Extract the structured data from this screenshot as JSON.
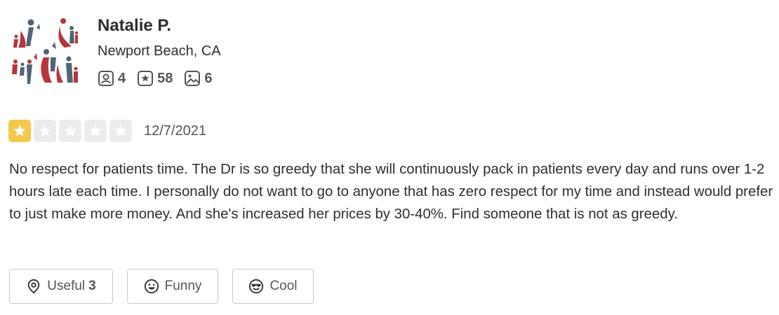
{
  "user": {
    "name": "Natalie P.",
    "location": "Newport Beach, CA",
    "stats": [
      {
        "icon": "friends-icon",
        "value": "4"
      },
      {
        "icon": "review-star-icon",
        "value": "58"
      },
      {
        "icon": "photo-icon",
        "value": "6"
      }
    ]
  },
  "review": {
    "rating": 1,
    "max_rating": 5,
    "date": "12/7/2021",
    "text": "No respect for patients time. The Dr is so greedy that she will continuously pack in patients every day and runs over 1-2 hours late each time. I personally do not want to go to anyone that has zero respect for my time and instead would prefer to just make more money. And she's increased her prices by 30-40%. Find someone that is not as greedy."
  },
  "reactions": [
    {
      "icon": "useful-icon",
      "label": "Useful",
      "count": "3"
    },
    {
      "icon": "funny-icon",
      "label": "Funny",
      "count": ""
    },
    {
      "icon": "cool-icon",
      "label": "Cool",
      "count": ""
    }
  ],
  "colors": {
    "star_on": "#f2c94c",
    "star_off": "#ececec",
    "avatar_red": "#b5363b",
    "avatar_slate": "#4f6575"
  }
}
